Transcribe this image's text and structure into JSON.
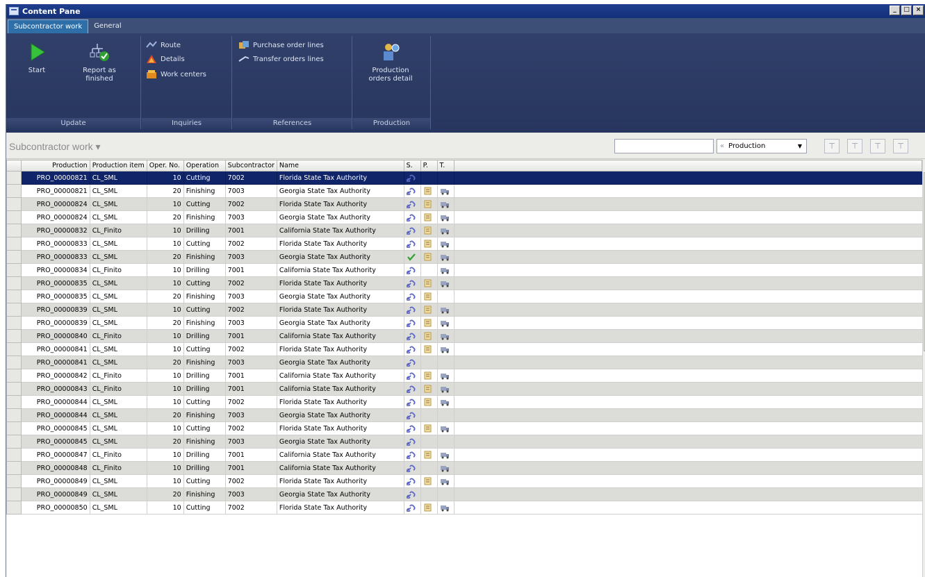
{
  "window": {
    "title": "Content Pane",
    "controls": [
      "minimize",
      "maximize",
      "close"
    ]
  },
  "tabs": [
    {
      "label": "Subcontractor work",
      "active": true
    },
    {
      "label": "General",
      "active": false
    }
  ],
  "ribbon": {
    "update": {
      "label": "Update",
      "start": "Start",
      "report_as_finished": "Report as finished"
    },
    "inquiries": {
      "label": "Inquiries",
      "route": "Route",
      "details": "Details",
      "work_centers": "Work centers"
    },
    "references": {
      "label": "References",
      "purchase_order_lines": "Purchase order lines",
      "transfer_orders_lines": "Transfer orders lines"
    },
    "production": {
      "label": "Production",
      "production_orders_detail": "Production orders detail"
    }
  },
  "subheader": {
    "caption": "Subcontractor work ▾",
    "filter_value": "",
    "filter_field": "Production",
    "filter_buttons": [
      "filter-icon",
      "filter-by-selection-icon",
      "advanced-filter-icon",
      "remove-filter-icon"
    ]
  },
  "grid": {
    "columns": [
      "Production",
      "Production item",
      "Oper. No.",
      "Operation",
      "Subcontractor",
      "Name",
      "S.",
      "P.",
      "T."
    ],
    "rows": [
      {
        "production": "PRO_00000821",
        "item": "CL_SML",
        "oper": "10",
        "operation": "Cutting",
        "sub": "7002",
        "name": "Florida State Tax Authority",
        "s": "link",
        "p": "",
        "t": "",
        "selected": true
      },
      {
        "production": "PRO_00000821",
        "item": "CL_SML",
        "oper": "20",
        "operation": "Finishing",
        "sub": "7003",
        "name": "Georgia State Tax Authority",
        "s": "link",
        "p": "note",
        "t": "truck"
      },
      {
        "production": "PRO_00000824",
        "item": "CL_SML",
        "oper": "10",
        "operation": "Cutting",
        "sub": "7002",
        "name": "Florida State Tax Authority",
        "s": "link",
        "p": "note",
        "t": "truck"
      },
      {
        "production": "PRO_00000824",
        "item": "CL_SML",
        "oper": "20",
        "operation": "Finishing",
        "sub": "7003",
        "name": "Georgia State Tax Authority",
        "s": "link",
        "p": "note",
        "t": "truck"
      },
      {
        "production": "PRO_00000832",
        "item": "CL_Finito",
        "oper": "10",
        "operation": "Drilling",
        "sub": "7001",
        "name": "California State Tax Authority",
        "s": "link",
        "p": "note",
        "t": "truck"
      },
      {
        "production": "PRO_00000833",
        "item": "CL_SML",
        "oper": "10",
        "operation": "Cutting",
        "sub": "7002",
        "name": "Florida State Tax Authority",
        "s": "link",
        "p": "note",
        "t": "truck"
      },
      {
        "production": "PRO_00000833",
        "item": "CL_SML",
        "oper": "20",
        "operation": "Finishing",
        "sub": "7003",
        "name": "Georgia State Tax Authority",
        "s": "check",
        "p": "note",
        "t": "truck"
      },
      {
        "production": "PRO_00000834",
        "item": "CL_Finito",
        "oper": "10",
        "operation": "Drilling",
        "sub": "7001",
        "name": "California State Tax Authority",
        "s": "link",
        "p": "",
        "t": "truck"
      },
      {
        "production": "PRO_00000835",
        "item": "CL_SML",
        "oper": "10",
        "operation": "Cutting",
        "sub": "7002",
        "name": "Florida State Tax Authority",
        "s": "link",
        "p": "note",
        "t": "truck"
      },
      {
        "production": "PRO_00000835",
        "item": "CL_SML",
        "oper": "20",
        "operation": "Finishing",
        "sub": "7003",
        "name": "Georgia State Tax Authority",
        "s": "link",
        "p": "note",
        "t": ""
      },
      {
        "production": "PRO_00000839",
        "item": "CL_SML",
        "oper": "10",
        "operation": "Cutting",
        "sub": "7002",
        "name": "Florida State Tax Authority",
        "s": "link",
        "p": "note",
        "t": "truck"
      },
      {
        "production": "PRO_00000839",
        "item": "CL_SML",
        "oper": "20",
        "operation": "Finishing",
        "sub": "7003",
        "name": "Georgia State Tax Authority",
        "s": "link",
        "p": "note",
        "t": "truck"
      },
      {
        "production": "PRO_00000840",
        "item": "CL_Finito",
        "oper": "10",
        "operation": "Drilling",
        "sub": "7001",
        "name": "California State Tax Authority",
        "s": "link",
        "p": "note",
        "t": "truck"
      },
      {
        "production": "PRO_00000841",
        "item": "CL_SML",
        "oper": "10",
        "operation": "Cutting",
        "sub": "7002",
        "name": "Florida State Tax Authority",
        "s": "link",
        "p": "note",
        "t": "truck"
      },
      {
        "production": "PRO_00000841",
        "item": "CL_SML",
        "oper": "20",
        "operation": "Finishing",
        "sub": "7003",
        "name": "Georgia State Tax Authority",
        "s": "link",
        "p": "",
        "t": ""
      },
      {
        "production": "PRO_00000842",
        "item": "CL_Finito",
        "oper": "10",
        "operation": "Drilling",
        "sub": "7001",
        "name": "California State Tax Authority",
        "s": "link",
        "p": "note",
        "t": "truck"
      },
      {
        "production": "PRO_00000843",
        "item": "CL_Finito",
        "oper": "10",
        "operation": "Drilling",
        "sub": "7001",
        "name": "California State Tax Authority",
        "s": "link",
        "p": "note",
        "t": "truck"
      },
      {
        "production": "PRO_00000844",
        "item": "CL_SML",
        "oper": "10",
        "operation": "Cutting",
        "sub": "7002",
        "name": "Florida State Tax Authority",
        "s": "link",
        "p": "note",
        "t": "truck"
      },
      {
        "production": "PRO_00000844",
        "item": "CL_SML",
        "oper": "20",
        "operation": "Finishing",
        "sub": "7003",
        "name": "Georgia State Tax Authority",
        "s": "link",
        "p": "",
        "t": ""
      },
      {
        "production": "PRO_00000845",
        "item": "CL_SML",
        "oper": "10",
        "operation": "Cutting",
        "sub": "7002",
        "name": "Florida State Tax Authority",
        "s": "link",
        "p": "note",
        "t": "truck"
      },
      {
        "production": "PRO_00000845",
        "item": "CL_SML",
        "oper": "20",
        "operation": "Finishing",
        "sub": "7003",
        "name": "Georgia State Tax Authority",
        "s": "link",
        "p": "",
        "t": ""
      },
      {
        "production": "PRO_00000847",
        "item": "CL_Finito",
        "oper": "10",
        "operation": "Drilling",
        "sub": "7001",
        "name": "California State Tax Authority",
        "s": "link",
        "p": "note",
        "t": "truck"
      },
      {
        "production": "PRO_00000848",
        "item": "CL_Finito",
        "oper": "10",
        "operation": "Drilling",
        "sub": "7001",
        "name": "California State Tax Authority",
        "s": "link",
        "p": "",
        "t": "truck"
      },
      {
        "production": "PRO_00000849",
        "item": "CL_SML",
        "oper": "10",
        "operation": "Cutting",
        "sub": "7002",
        "name": "Florida State Tax Authority",
        "s": "link",
        "p": "note",
        "t": "truck"
      },
      {
        "production": "PRO_00000849",
        "item": "CL_SML",
        "oper": "20",
        "operation": "Finishing",
        "sub": "7003",
        "name": "Georgia State Tax Authority",
        "s": "link",
        "p": "",
        "t": ""
      },
      {
        "production": "PRO_00000850",
        "item": "CL_SML",
        "oper": "10",
        "operation": "Cutting",
        "sub": "7002",
        "name": "Florida State Tax Authority",
        "s": "link",
        "p": "note",
        "t": "truck"
      }
    ]
  },
  "colors": {
    "title_bar": "#13307a",
    "ribbon": "#2c3b63",
    "selected_row": "#10246a",
    "alt_row": "#dcdcd8"
  }
}
